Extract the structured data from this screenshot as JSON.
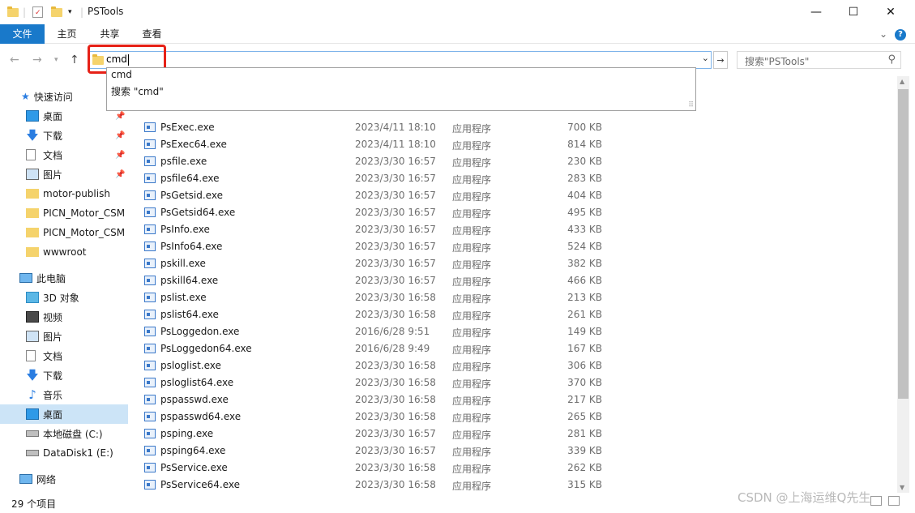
{
  "window": {
    "title": "PSTools",
    "minimize": "—",
    "maximize": "☐",
    "close": "✕"
  },
  "ribbon": {
    "tabs": [
      "文件",
      "主页",
      "共享",
      "查看"
    ],
    "collapse": "⌄",
    "help": "?"
  },
  "address": {
    "value": "cmd",
    "dropdown": "⌄",
    "go": "→"
  },
  "search": {
    "placeholder": "搜索\"PSTools\""
  },
  "autocomplete": {
    "items": [
      "cmd",
      "搜索 \"cmd\""
    ]
  },
  "nav": {
    "quick_access": "快速访问",
    "pinned": [
      {
        "label": "桌面",
        "icon": "desktop-icon"
      },
      {
        "label": "下载",
        "icon": "download-icon"
      },
      {
        "label": "文档",
        "icon": "document-icon"
      },
      {
        "label": "图片",
        "icon": "picture-icon"
      }
    ],
    "folders": [
      "motor-publish",
      "PICN_Motor_CSM",
      "PICN_Motor_CSM",
      "wwwroot"
    ],
    "this_pc": "此电脑",
    "pc_items": [
      {
        "label": "3D 对象",
        "icon": "3d-objects-icon"
      },
      {
        "label": "视频",
        "icon": "video-icon"
      },
      {
        "label": "图片",
        "icon": "picture-icon"
      },
      {
        "label": "文档",
        "icon": "document-icon"
      },
      {
        "label": "下载",
        "icon": "download-icon"
      },
      {
        "label": "音乐",
        "icon": "music-icon"
      },
      {
        "label": "桌面",
        "icon": "desktop-icon"
      },
      {
        "label": "本地磁盘 (C:)",
        "icon": "drive-icon"
      },
      {
        "label": "DataDisk1 (E:)",
        "icon": "drive-icon"
      }
    ],
    "network": "网络"
  },
  "files": [
    {
      "name": "PsExec.exe",
      "date": "2023/4/11 18:10",
      "type": "应用程序",
      "size": "700 KB"
    },
    {
      "name": "PsExec64.exe",
      "date": "2023/4/11 18:10",
      "type": "应用程序",
      "size": "814 KB"
    },
    {
      "name": "psfile.exe",
      "date": "2023/3/30 16:57",
      "type": "应用程序",
      "size": "230 KB"
    },
    {
      "name": "psfile64.exe",
      "date": "2023/3/30 16:57",
      "type": "应用程序",
      "size": "283 KB"
    },
    {
      "name": "PsGetsid.exe",
      "date": "2023/3/30 16:57",
      "type": "应用程序",
      "size": "404 KB"
    },
    {
      "name": "PsGetsid64.exe",
      "date": "2023/3/30 16:57",
      "type": "应用程序",
      "size": "495 KB"
    },
    {
      "name": "PsInfo.exe",
      "date": "2023/3/30 16:57",
      "type": "应用程序",
      "size": "433 KB"
    },
    {
      "name": "PsInfo64.exe",
      "date": "2023/3/30 16:57",
      "type": "应用程序",
      "size": "524 KB"
    },
    {
      "name": "pskill.exe",
      "date": "2023/3/30 16:57",
      "type": "应用程序",
      "size": "382 KB"
    },
    {
      "name": "pskill64.exe",
      "date": "2023/3/30 16:57",
      "type": "应用程序",
      "size": "466 KB"
    },
    {
      "name": "pslist.exe",
      "date": "2023/3/30 16:58",
      "type": "应用程序",
      "size": "213 KB"
    },
    {
      "name": "pslist64.exe",
      "date": "2023/3/30 16:58",
      "type": "应用程序",
      "size": "261 KB"
    },
    {
      "name": "PsLoggedon.exe",
      "date": "2016/6/28 9:51",
      "type": "应用程序",
      "size": "149 KB"
    },
    {
      "name": "PsLoggedon64.exe",
      "date": "2016/6/28 9:49",
      "type": "应用程序",
      "size": "167 KB"
    },
    {
      "name": "psloglist.exe",
      "date": "2023/3/30 16:58",
      "type": "应用程序",
      "size": "306 KB"
    },
    {
      "name": "psloglist64.exe",
      "date": "2023/3/30 16:58",
      "type": "应用程序",
      "size": "370 KB"
    },
    {
      "name": "pspasswd.exe",
      "date": "2023/3/30 16:58",
      "type": "应用程序",
      "size": "217 KB"
    },
    {
      "name": "pspasswd64.exe",
      "date": "2023/3/30 16:58",
      "type": "应用程序",
      "size": "265 KB"
    },
    {
      "name": "psping.exe",
      "date": "2023/3/30 16:57",
      "type": "应用程序",
      "size": "281 KB"
    },
    {
      "name": "psping64.exe",
      "date": "2023/3/30 16:57",
      "type": "应用程序",
      "size": "339 KB"
    },
    {
      "name": "PsService.exe",
      "date": "2023/3/30 16:58",
      "type": "应用程序",
      "size": "262 KB"
    },
    {
      "name": "PsService64.exe",
      "date": "2023/3/30 16:58",
      "type": "应用程序",
      "size": "315 KB"
    }
  ],
  "status": {
    "count": "29 个项目"
  },
  "watermark": "CSDN @上海运维Q先生"
}
